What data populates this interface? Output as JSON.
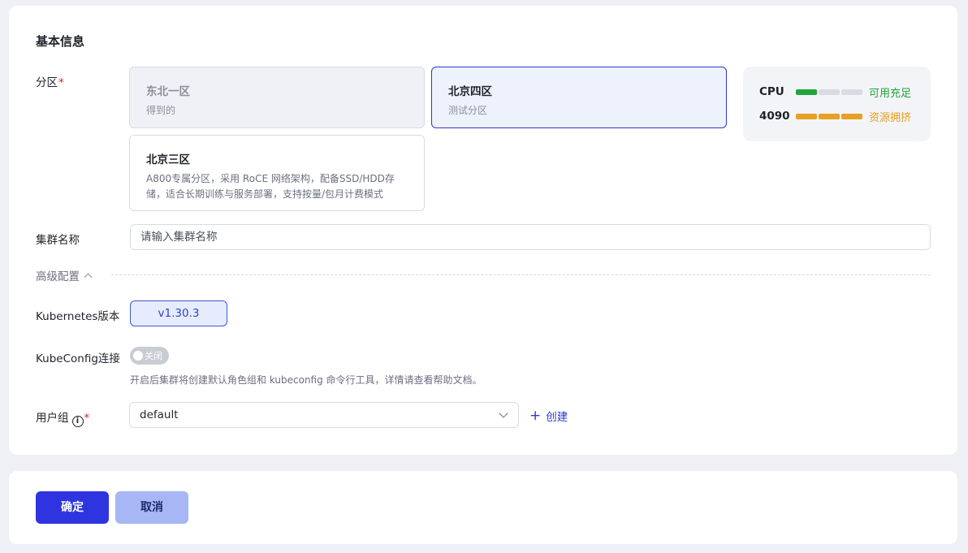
{
  "basic_info": {
    "title": "基本信息"
  },
  "zone": {
    "label": "分区",
    "required_mark": "*",
    "options": [
      {
        "title": "东北一区",
        "desc": "得到的",
        "state": "disabled"
      },
      {
        "title": "北京四区",
        "desc": "测试分区",
        "state": "selected"
      },
      {
        "title": "北京三区",
        "desc": "A800专属分区，采用 RoCE 网络架构，配备SSD/HDD存储，适合长期训练与服务部署，支持按量/包月计费模式",
        "state": "normal"
      }
    ]
  },
  "resources": [
    {
      "name": "CPU",
      "status": "可用充足",
      "level": 1,
      "total": 3,
      "color": "#22a43a"
    },
    {
      "name": "4090",
      "status": "资源拥挤",
      "level": 3,
      "total": 3,
      "color": "#e6a024"
    }
  ],
  "cluster_name": {
    "label": "集群名称",
    "placeholder": "请输入集群名称"
  },
  "advanced": {
    "label": "高级配置"
  },
  "kubernetes": {
    "label": "Kubernetes版本",
    "version": "v1.30.3"
  },
  "kubeconfig": {
    "label": "KubeConfig连接",
    "switch_text": "关闭",
    "help": "开启后集群将创建默认角色组和 kubeconfig 命令行工具，详情请查看帮助文档。"
  },
  "user_group": {
    "label": "用户组",
    "info_glyph": "i",
    "required_mark": "*",
    "value": "default",
    "create_label": "创建",
    "create_glyph": "+"
  },
  "footer": {
    "confirm_label": "确定",
    "cancel_label": "取消"
  }
}
